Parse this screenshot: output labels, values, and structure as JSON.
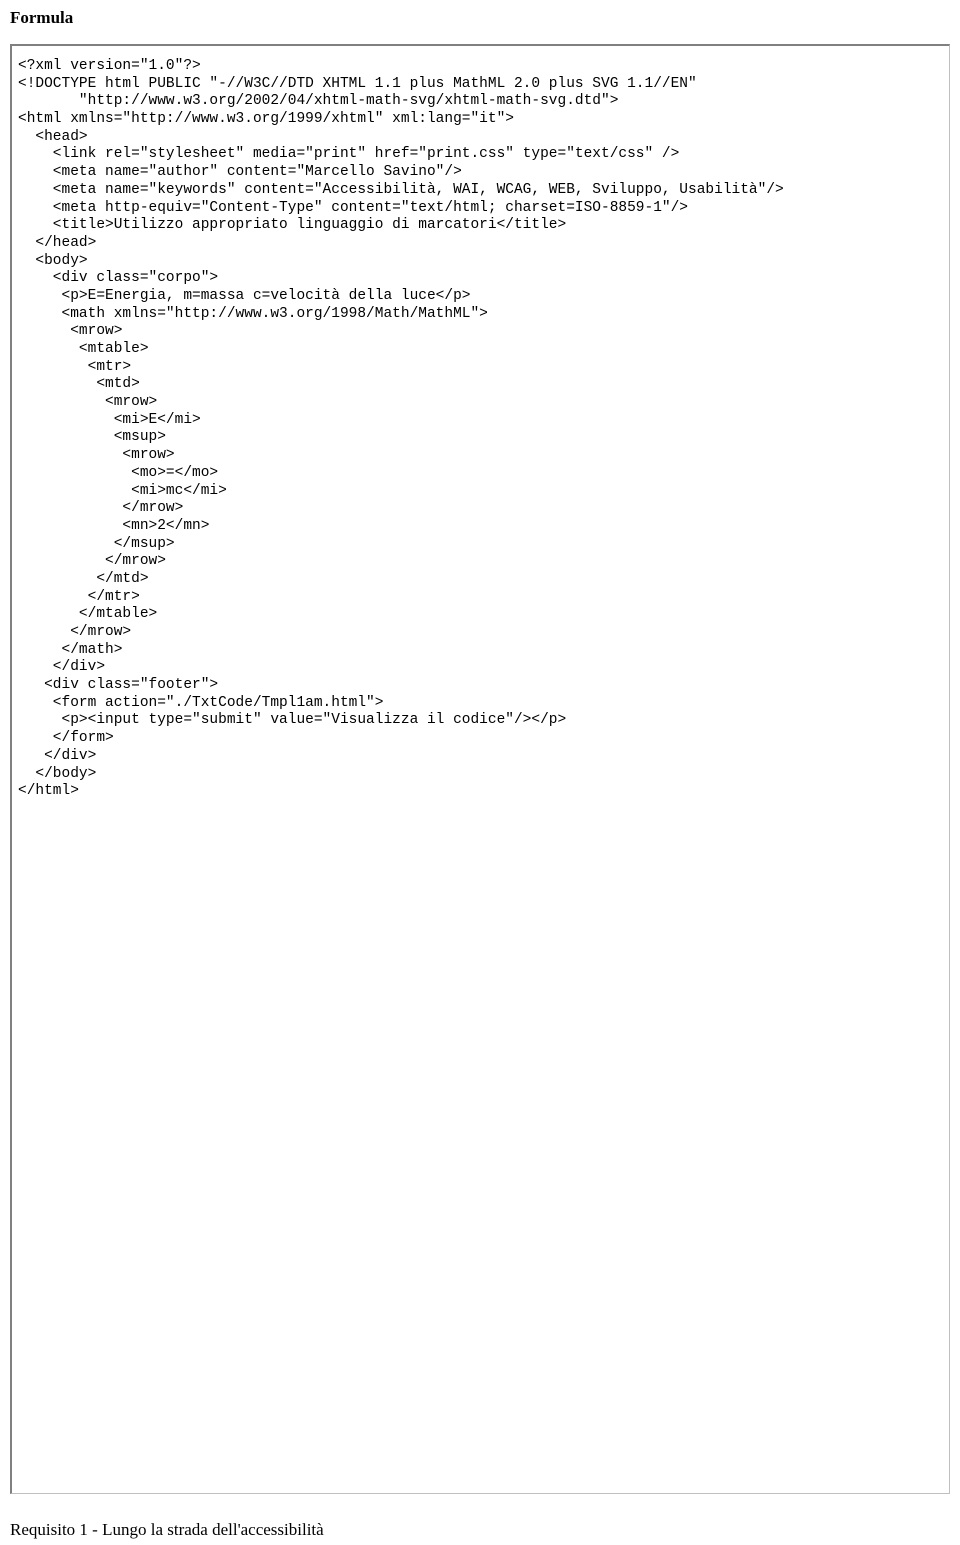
{
  "heading": "Formula",
  "code_lines": [
    "<?xml version=\"1.0\"?>",
    "<!DOCTYPE html PUBLIC \"-//W3C//DTD XHTML 1.1 plus MathML 2.0 plus SVG 1.1//EN\"",
    "       \"http://www.w3.org/2002/04/xhtml-math-svg/xhtml-math-svg.dtd\">",
    "<html xmlns=\"http://www.w3.org/1999/xhtml\" xml:lang=\"it\">",
    "  <head>",
    "    <link rel=\"stylesheet\" media=\"print\" href=\"print.css\" type=\"text/css\" />",
    "    <meta name=\"author\" content=\"Marcello Savino\"/>",
    "    <meta name=\"keywords\" content=\"Accessibilità, WAI, WCAG, WEB, Sviluppo, Usabilità\"/>",
    "    <meta http-equiv=\"Content-Type\" content=\"text/html; charset=ISO-8859-1\"/>",
    "    <title>Utilizzo appropriato linguaggio di marcatori</title>",
    "  </head>",
    "  <body>",
    "    <div class=\"corpo\">",
    "     <p>E=Energia, m=massa c=velocità della luce</p>",
    "     <math xmlns=\"http://www.w3.org/1998/Math/MathML\">",
    "      <mrow>",
    "       <mtable>",
    "        <mtr>",
    "         <mtd>",
    "          <mrow>",
    "           <mi>E</mi>",
    "           <msup>",
    "            <mrow>",
    "             <mo>=</mo>",
    "             <mi>mc</mi>",
    "            </mrow>",
    "            <mn>2</mn>",
    "           </msup>",
    "          </mrow>",
    "         </mtd>",
    "        </mtr>",
    "       </mtable>",
    "      </mrow>",
    "     </math>",
    "    </div>",
    "   <div class=\"footer\">",
    "    <form action=\"./TxtCode/Tmpl1am.html\">",
    "     <p><input type=\"submit\" value=\"Visualizza il codice\"/></p>",
    "    </form>",
    "   </div>",
    "  </body>",
    "</html>"
  ],
  "footer": "Requisito 1 - Lungo la strada dell'accessibilità"
}
